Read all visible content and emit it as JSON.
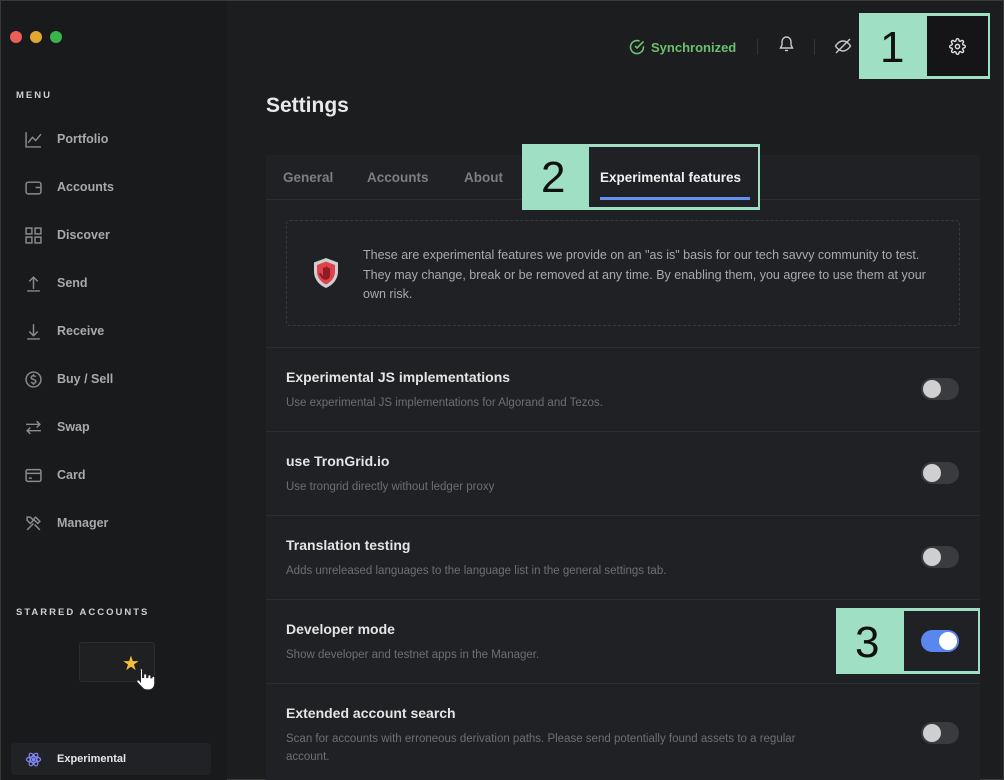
{
  "sidebar": {
    "menu_title": "MENU",
    "items": [
      {
        "label": "Portfolio",
        "icon": "chart-icon"
      },
      {
        "label": "Accounts",
        "icon": "wallet-icon"
      },
      {
        "label": "Discover",
        "icon": "grid-icon"
      },
      {
        "label": "Send",
        "icon": "arrow-up-icon"
      },
      {
        "label": "Receive",
        "icon": "arrow-down-icon"
      },
      {
        "label": "Buy / Sell",
        "icon": "dollar-icon"
      },
      {
        "label": "Swap",
        "icon": "swap-icon"
      },
      {
        "label": "Card",
        "icon": "card-icon"
      },
      {
        "label": "Manager",
        "icon": "tools-icon"
      }
    ],
    "starred_title": "STARRED ACCOUNTS",
    "experimental_label": "Experimental"
  },
  "topbar": {
    "sync_label": "Synchronized"
  },
  "callouts": {
    "one": "1",
    "two": "2",
    "three": "3"
  },
  "page_title": "Settings",
  "tabs": [
    {
      "label": "General"
    },
    {
      "label": "Accounts"
    },
    {
      "label": "About"
    },
    {
      "label": "Experimental features",
      "active": true
    }
  ],
  "disclaimer": "These are experimental features we provide on an \"as is\" basis for our tech savvy community to test. They may change, break or be removed at any time. By enabling them, you agree to use them at your own risk.",
  "features": [
    {
      "title": "Experimental JS implementations",
      "desc": "Use experimental JS implementations for Algorand and Tezos.",
      "enabled": false
    },
    {
      "title": "use TronGrid.io",
      "desc": "Use trongrid directly without ledger proxy",
      "enabled": false
    },
    {
      "title": "Translation testing",
      "desc": "Adds unreleased languages to the language list in the general settings tab.",
      "enabled": false
    },
    {
      "title": "Developer mode",
      "desc": "Show developer and testnet apps in the Manager.",
      "enabled": true
    },
    {
      "title": "Extended account search",
      "desc": "Scan for accounts with erroneous derivation paths. Please send potentially found assets to a regular account.",
      "enabled": false
    }
  ],
  "colors": {
    "accent": "#6490f1",
    "sync": "#6cc070",
    "callout": "#9fe0c5",
    "star": "#f2c037"
  }
}
